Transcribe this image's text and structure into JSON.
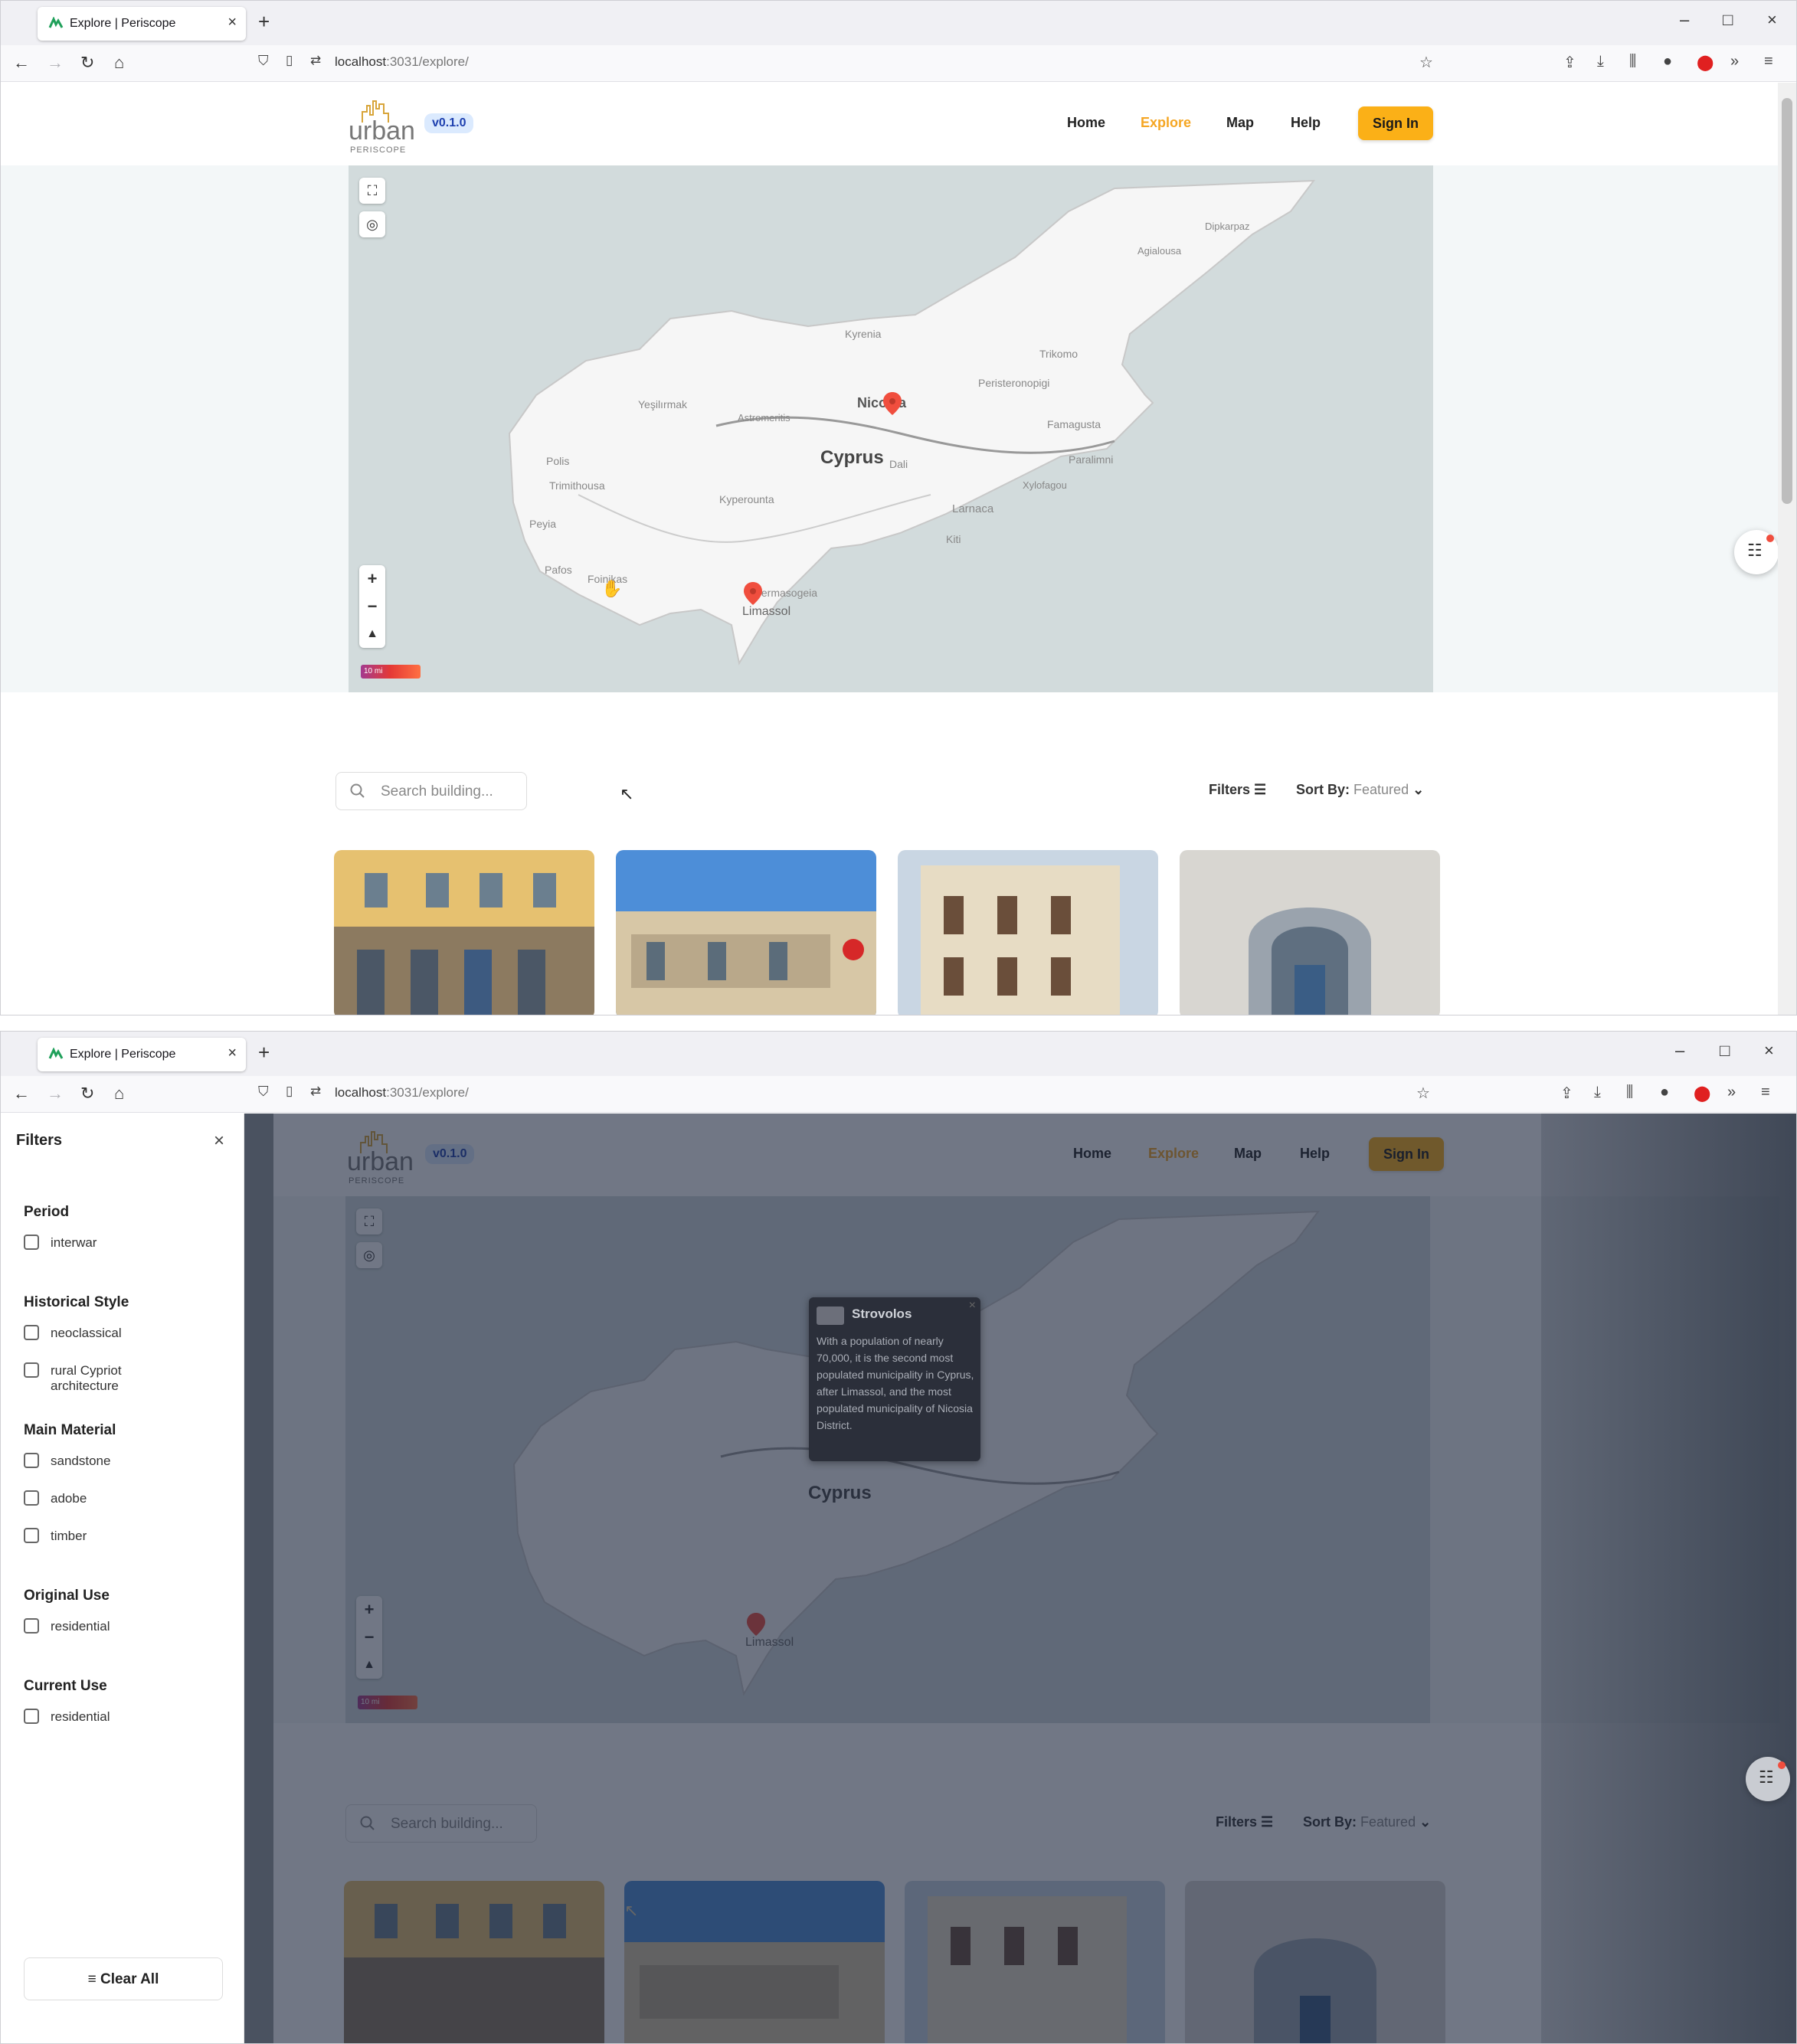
{
  "browser": {
    "tab_title": "Explore | Periscope",
    "url_host": "localhost",
    "url_rest": ":3031/explore/"
  },
  "site": {
    "logo_word": "urban",
    "logo_sub": "PERISCOPE",
    "version": "v0.1.0",
    "nav": [
      "Home",
      "Explore",
      "Map",
      "Help"
    ],
    "active_nav": "Explore",
    "sign_in": "Sign In"
  },
  "map": {
    "title": "Cyprus",
    "places": [
      "Dipkarpaz",
      "Agialousa",
      "Kyrenia",
      "Trikomo",
      "Peristeronopigi",
      "Yeşilırmak",
      "Astromeritis",
      "Nicosia",
      "Famagusta",
      "Paralimni",
      "Polis",
      "Dali",
      "Xylofagou",
      "Trimithousa",
      "Kyperounta",
      "Larnaca",
      "Peyia",
      "Kiti",
      "Pafos",
      "Foinikas",
      "Germasogeia",
      "Limassol"
    ],
    "scale_label": "10 mi",
    "zoom_in": "+",
    "zoom_out": "−"
  },
  "listing": {
    "search_placeholder": "Search building...",
    "filters_label": "Filters",
    "sort_label": "Sort By:",
    "sort_value": "Featured"
  },
  "popup": {
    "title": "Strovolos",
    "body": "With a population of nearly 70,000, it is the second most populated municipality in Cyprus, after Limassol, and the most populated municipality of Nicosia District."
  },
  "filters_panel": {
    "title": "Filters",
    "groups": [
      {
        "name": "Period",
        "options": [
          "interwar"
        ]
      },
      {
        "name": "Historical Style",
        "options": [
          "neoclassical",
          "rural Cypriot architecture"
        ]
      },
      {
        "name": "Main Material",
        "options": [
          "sandstone",
          "adobe",
          "timber"
        ]
      },
      {
        "name": "Original Use",
        "options": [
          "residential"
        ]
      },
      {
        "name": "Current Use",
        "options": [
          "residential"
        ]
      }
    ],
    "clear_all": "Clear All"
  },
  "colors": {
    "accent": "#fbb017",
    "marker": "#f04e3e",
    "version_badge_bg": "#dbeafe"
  }
}
